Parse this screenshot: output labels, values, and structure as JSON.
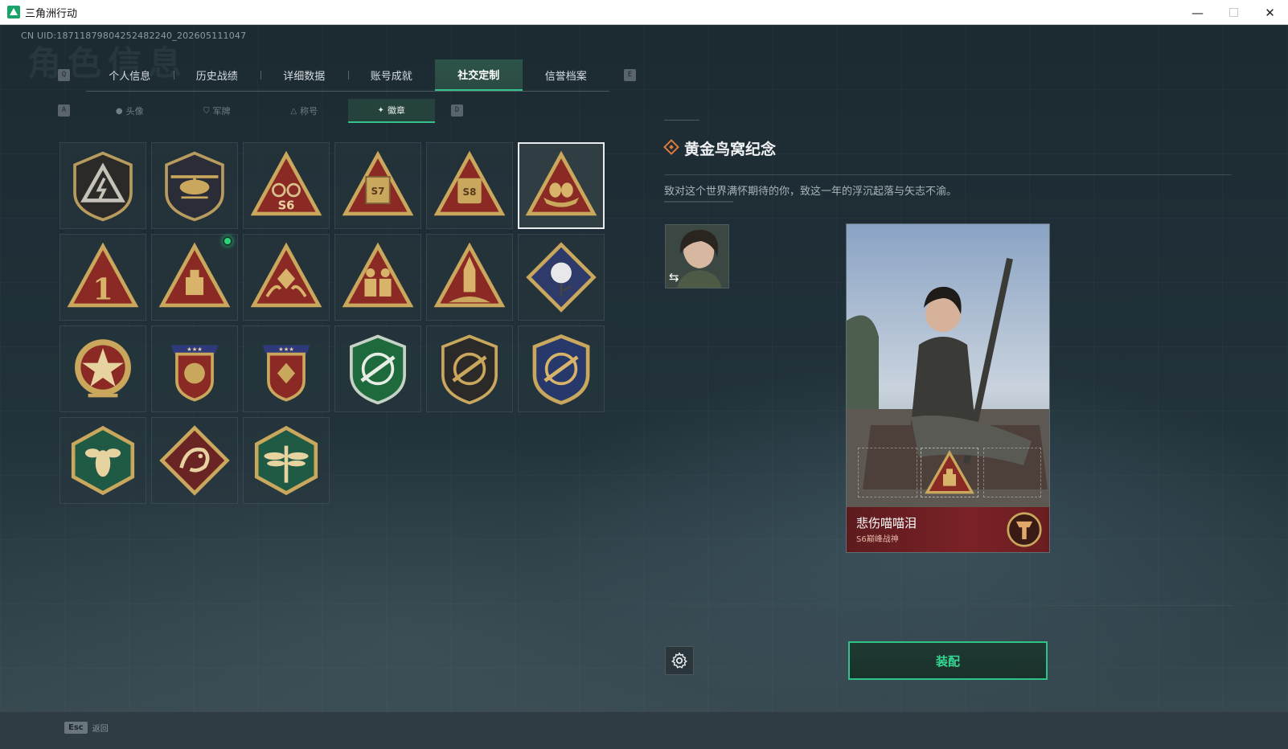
{
  "window": {
    "title": "三角洲行动",
    "minimize_glyph": "—",
    "maximize_glyph": "☐",
    "close_glyph": "✕"
  },
  "uid_text": "CN UID:18711879804252482240_202605111047",
  "background_title": "角色信息",
  "main_tabs": {
    "prev_key": "Q",
    "next_key": "E",
    "items": [
      {
        "label": "个人信息"
      },
      {
        "label": "历史战绩"
      },
      {
        "label": "详细数据"
      },
      {
        "label": "账号成就"
      },
      {
        "label": "社交定制",
        "active": true
      },
      {
        "label": "信誉档案"
      }
    ]
  },
  "sub_tabs": {
    "prev_key": "A",
    "next_key": "D",
    "items": [
      {
        "label": "头像",
        "icon": "person-icon"
      },
      {
        "label": "军牌",
        "icon": "dogtag-icon"
      },
      {
        "label": "称号",
        "icon": "title-icon"
      },
      {
        "label": "徽章",
        "icon": "badge-icon",
        "active": true
      }
    ]
  },
  "badges": [
    {
      "name": "badge-shield-lightning"
    },
    {
      "name": "badge-helicopter"
    },
    {
      "name": "badge-s6-triangle"
    },
    {
      "name": "badge-s7-triangle"
    },
    {
      "name": "badge-s8-triangle"
    },
    {
      "name": "badge-golden-nest",
      "selected": true
    },
    {
      "name": "badge-number-one"
    },
    {
      "name": "badge-usb-drive",
      "new": true
    },
    {
      "name": "badge-hands-gem"
    },
    {
      "name": "badge-soldiers"
    },
    {
      "name": "badge-rocket"
    },
    {
      "name": "badge-rose-diamond"
    },
    {
      "name": "badge-star-medal"
    },
    {
      "name": "badge-wreath-crest-1"
    },
    {
      "name": "badge-wreath-crest-2"
    },
    {
      "name": "badge-green-shield-rifle"
    },
    {
      "name": "badge-dark-shield-rifle"
    },
    {
      "name": "badge-blue-shield-rifle"
    },
    {
      "name": "badge-hex-wasp"
    },
    {
      "name": "badge-diamond-dragon"
    },
    {
      "name": "badge-hex-dragonfly"
    }
  ],
  "detail": {
    "title": "黄金鸟窝纪念",
    "description": "致对这个世界满怀期待的你，致这一年的浮沉起落与矢志不渝。"
  },
  "card": {
    "player_name": "悲伤喵喵泪",
    "player_subtitle": "S6巅峰战神"
  },
  "actions": {
    "equip_label": "装配"
  },
  "bottom": {
    "esc_key": "Esc",
    "esc_label": "返回"
  },
  "colors": {
    "accent": "#35c28a",
    "gold": "#c9a75c",
    "badge_red": "#8b2a24",
    "card_red": "#7a2226"
  }
}
